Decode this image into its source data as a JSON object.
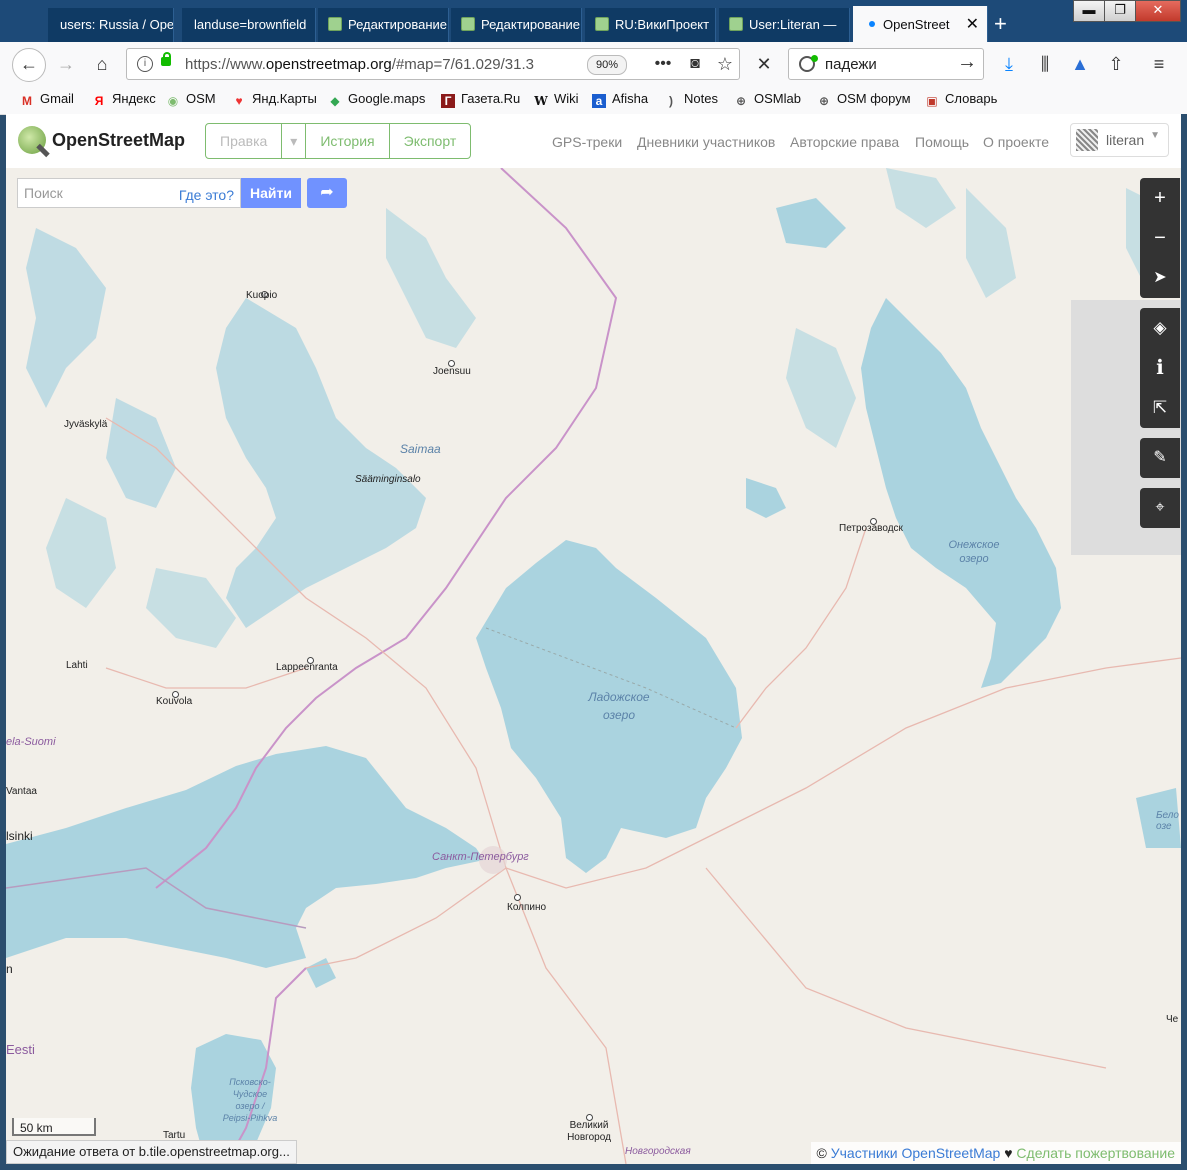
{
  "tabs": [
    {
      "label": "users: Russia / Ope",
      "active": false
    },
    {
      "label": "landuse=brownfield",
      "active": false
    },
    {
      "label": "Редактирование",
      "active": false
    },
    {
      "label": "Редактирование",
      "active": false
    },
    {
      "label": "RU:ВикиПроект",
      "active": false
    },
    {
      "label": "User:Literan —",
      "active": false
    },
    {
      "label": "OpenStreet",
      "active": true
    }
  ],
  "window_controls": {
    "minimize": "▬",
    "maximize": "❐",
    "close": "✕"
  },
  "toolbar": {
    "url_prefix": "https://www.",
    "url_host": "openstreetmap.org",
    "url_rest": "/#map=7/61.029/31.3",
    "zoom": "90%",
    "search_value": "падежи"
  },
  "bookmarks": [
    {
      "label": "Gmail",
      "icon": "gmail-icon"
    },
    {
      "label": "Яндекс",
      "icon": "yandex-icon"
    },
    {
      "label": "OSM",
      "icon": "osm-icon"
    },
    {
      "label": "Янд.Карты",
      "icon": "pin-icon"
    },
    {
      "label": "Google.maps",
      "icon": "google-maps-icon"
    },
    {
      "label": "Газета.Ru",
      "icon": "gazeta-icon"
    },
    {
      "label": "Wiki",
      "icon": "wikipedia-icon"
    },
    {
      "label": "Afisha",
      "icon": "afisha-icon"
    },
    {
      "label": "Notes",
      "icon": "rss-icon"
    },
    {
      "label": "OSMlab",
      "icon": "globe-icon"
    },
    {
      "label": "OSM форум",
      "icon": "globe-icon"
    },
    {
      "label": "Словарь",
      "icon": "dictionary-icon"
    }
  ],
  "osm_header": {
    "brand": "OpenStreetMap",
    "edit": "Правка",
    "history": "История",
    "export": "Экспорт",
    "links": [
      "GPS-треки",
      "Дневники участников",
      "Авторские права",
      "Помощь",
      "О проекте"
    ],
    "user": "literan"
  },
  "search": {
    "placeholder": "Поиск",
    "where_is_this": "Где это?",
    "find": "Найти"
  },
  "map_labels": {
    "kuopio": "Kuopio",
    "joensuu": "Joensuu",
    "jyvaskyla": "Jyväskylä",
    "saimaa": "Saimaa",
    "saaminginsalo": "Sääminginsalo",
    "petrozavodsk": "Петрозаводск",
    "onega": "Онежское озеро",
    "ladoga": "Ладожское озеро",
    "lahti": "Lahti",
    "lappeenranta": "Lappeenranta",
    "kouvola": "Kouvola",
    "uusimaa": "ela-Suomi",
    "vantaa": "Vantaa",
    "helsinki": "lsinki",
    "spb": "Санкт-Петербург",
    "kolpino": "Колпино",
    "beloe": "Бело озе",
    "eesti": "Eesti",
    "peipsi": "Псковско-Чудское озеро / Peipsi-Pihkva",
    "tartu": "Tartu",
    "novgorod": "Великий Новгород",
    "novgorod_region": "Новгородская",
    "che": "Че",
    "n": "n"
  },
  "scale": "50 km",
  "status": "Ожидание ответа от b.tile.openstreetmap.org...",
  "attribution": {
    "copy": "©",
    "contributors": "Участники OpenStreetMap",
    "heart": "♥",
    "donate": "Сделать пожертвование"
  },
  "colors": {
    "water": "#aad3df",
    "land": "#f2efe9",
    "osm_green": "#7ebc6f",
    "search_blue": "#7092ff",
    "border_purple": "#c993c9"
  }
}
